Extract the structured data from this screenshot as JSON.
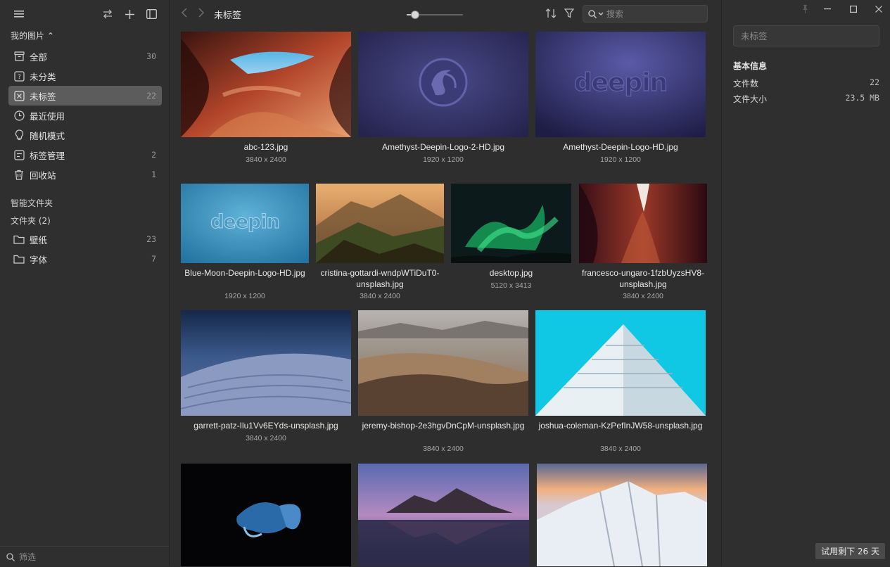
{
  "sidebar": {
    "library_title": "我的图片 ⌃",
    "items": [
      {
        "label": "全部",
        "count": "30"
      },
      {
        "label": "未分类",
        "count": ""
      },
      {
        "label": "未标签",
        "count": "22"
      },
      {
        "label": "最近使用",
        "count": ""
      },
      {
        "label": "随机模式",
        "count": ""
      },
      {
        "label": "标签管理",
        "count": "2"
      },
      {
        "label": "回收站",
        "count": "1"
      }
    ],
    "smart_folders_title": "智能文件夹",
    "folders_title": "文件夹 (2)",
    "folders": [
      {
        "label": "壁纸",
        "count": "23"
      },
      {
        "label": "字体",
        "count": "7"
      }
    ],
    "filter_placeholder": "筛选"
  },
  "topbar": {
    "breadcrumb": "未标签",
    "zoom_level": 0.15,
    "search_placeholder": "搜索"
  },
  "grid": {
    "items": [
      {
        "name": "abc-123.jpg",
        "dims": "3840 x 2400"
      },
      {
        "name": "Amethyst-Deepin-Logo-2-HD.jpg",
        "dims": "1920 x 1200"
      },
      {
        "name": "Amethyst-Deepin-Logo-HD.jpg",
        "dims": "1920 x 1200"
      },
      {
        "name": "Blue-Moon-Deepin-Logo-HD.jpg",
        "dims": "1920 x 1200"
      },
      {
        "name": "cristina-gottardi-wndpWTiDuT0-unsplash.jpg",
        "dims": "3840 x 2400"
      },
      {
        "name": "desktop.jpg",
        "dims": "5120 x 3413"
      },
      {
        "name": "francesco-ungaro-1fzbUyzsHV8-unsplash.jpg",
        "dims": "3840 x 2400"
      },
      {
        "name": "garrett-patz-Ilu1Vv6EYds-unsplash.jpg",
        "dims": "3840 x 2400"
      },
      {
        "name": "jeremy-bishop-2e3hgvDnCpM-unsplash.jpg",
        "dims": "3840 x 2400"
      },
      {
        "name": "joshua-coleman-KzPefInJW58-unsplash.jpg",
        "dims": "3840 x 2400"
      },
      {
        "name": "",
        "dims": ""
      },
      {
        "name": "",
        "dims": ""
      },
      {
        "name": "",
        "dims": ""
      }
    ]
  },
  "inspector": {
    "tag_placeholder": "未标签",
    "info_title": "基本信息",
    "file_count_label": "文件数",
    "file_count_value": "22",
    "file_size_label": "文件大小",
    "file_size_value": "23.5 MB",
    "trial_text": "试用剩下 26 天"
  },
  "colors": {
    "background": "#2e2e2e",
    "sidebar": "#2f2f2f",
    "active_item": "#5c5c5c"
  }
}
